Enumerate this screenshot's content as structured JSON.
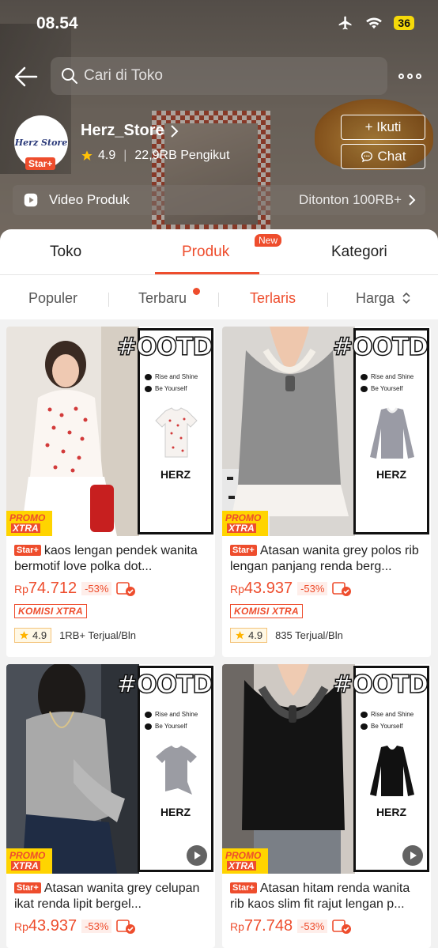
{
  "status_bar": {
    "time": "08.54",
    "battery": "36"
  },
  "search": {
    "placeholder": "Cari di Toko"
  },
  "shop": {
    "logo_text": "Herz Store",
    "badge": "Star+",
    "name": "Herz_Store",
    "rating": "4.9",
    "followers": "22,9RB Pengikut",
    "follow_label": "+ Ikuti",
    "chat_label": "Chat"
  },
  "video_bar": {
    "label": "Video Produk",
    "views": "Ditonton 100RB+"
  },
  "tabs": [
    {
      "label": "Toko"
    },
    {
      "label": "Produk",
      "badge": "New"
    },
    {
      "label": "Kategori"
    }
  ],
  "sort": [
    {
      "label": "Populer"
    },
    {
      "label": "Terbaru"
    },
    {
      "label": "Terlaris"
    },
    {
      "label": "Harga"
    }
  ],
  "colors": {
    "accent": "#ee4d2d",
    "promo_yellow": "#ffd400"
  },
  "products": [
    {
      "tag": "Star+",
      "title": "kaos lengan pendek wanita bermotif love polka dot...",
      "currency": "Rp",
      "price": "74.712",
      "discount": "-53%",
      "komisi": "KOMISI XTRA",
      "rating": "4.9",
      "sold": "1RB+ Terjual/Bln",
      "ootd": "#OOTD",
      "panel_line1": "Rise and Shine",
      "panel_line2": "Be Yourself",
      "brand": "HERZ",
      "promo_top": "PROMO",
      "promo_bottom": "XTRA"
    },
    {
      "tag": "Star+",
      "title": "Atasan wanita grey polos rib lengan panjang renda berg...",
      "currency": "Rp",
      "price": "43.937",
      "discount": "-53%",
      "komisi": "KOMISI XTRA",
      "rating": "4.9",
      "sold": "835 Terjual/Bln",
      "ootd": "#OOTD",
      "panel_line1": "Rise and Shine",
      "panel_line2": "Be Yourself",
      "brand": "HERZ",
      "promo_top": "PROMO",
      "promo_bottom": "XTRA"
    },
    {
      "tag": "Star+",
      "title": "Atasan wanita grey celupan ikat renda lipit bergel...",
      "currency": "Rp",
      "price": "43.937",
      "discount": "-53%",
      "ootd": "#OOTD",
      "panel_line1": "Rise and Shine",
      "panel_line2": "Be Yourself",
      "brand": "HERZ",
      "promo_top": "PROMO",
      "promo_bottom": "XTRA"
    },
    {
      "tag": "Star+",
      "title": "Atasan hitam renda wanita rib kaos slim fit rajut lengan p...",
      "currency": "Rp",
      "price": "77.748",
      "discount": "-53%",
      "ootd": "#OOTD",
      "panel_line1": "Rise and Shine",
      "panel_line2": "Be Yourself",
      "brand": "HERZ",
      "promo_top": "PROMO",
      "promo_bottom": "XTRA"
    }
  ]
}
